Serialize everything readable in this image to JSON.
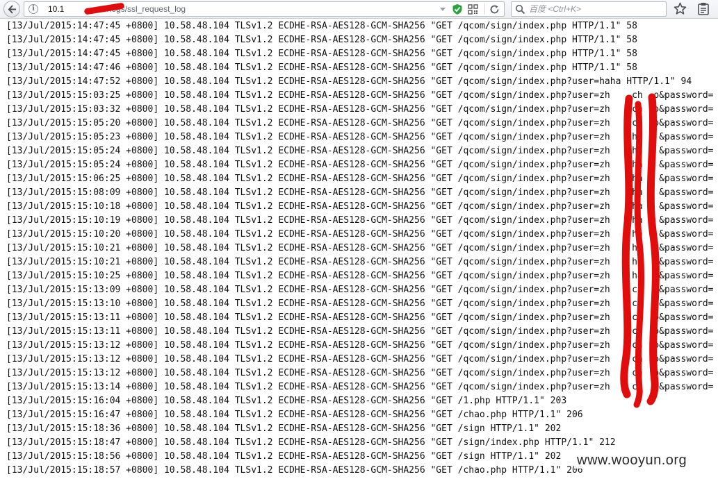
{
  "browser": {
    "url_host": "10.1",
    "url_path": "/logs/ssl_request_log",
    "search_placeholder": "百度 <Ctrl+K>",
    "icons": {
      "back": "back-arrow-icon",
      "info": "info-icon",
      "dropdown": "chevron-down-icon",
      "shield": "shield-check-icon",
      "qr": "qr-code-icon",
      "reload": "reload-icon",
      "search": "search-icon",
      "bookmark": "star-icon",
      "clipboard": "clipboard-icon"
    },
    "colors": {
      "shield": "#29a33b",
      "redaction": "#e10d0d"
    }
  },
  "log": {
    "lines": [
      "[13/Jul/2015:14:47:45 +0800] 10.58.48.104 TLSv1.2 ECDHE-RSA-AES128-GCM-SHA256 \"GET /qcom/sign/index.php HTTP/1.1\" 58",
      "[13/Jul/2015:14:47:45 +0800] 10.58.48.104 TLSv1.2 ECDHE-RSA-AES128-GCM-SHA256 \"GET /qcom/sign/index.php HTTP/1.1\" 58",
      "[13/Jul/2015:14:47:45 +0800] 10.58.48.104 TLSv1.2 ECDHE-RSA-AES128-GCM-SHA256 \"GET /qcom/sign/index.php HTTP/1.1\" 58",
      "[13/Jul/2015:14:47:46 +0800] 10.58.48.104 TLSv1.2 ECDHE-RSA-AES128-GCM-SHA256 \"GET /qcom/sign/index.php HTTP/1.1\" 58",
      "[13/Jul/2015:14:47:52 +0800] 10.58.48.104 TLSv1.2 ECDHE-RSA-AES128-GCM-SHA256 \"GET /qcom/sign/index.php?user=haha HTTP/1.1\" 94",
      "[13/Jul/2015:15:03:25 +0800] 10.58.48.104 TLSv1.2 ECDHE-RSA-AES128-GCM-SHA256 \"GET /qcom/sign/index.php?user=zh    ch  o&password=",
      "[13/Jul/2015:15:03:32 +0800] 10.58.48.104 TLSv1.2 ECDHE-RSA-AES128-GCM-SHA256 \"GET /qcom/sign/index.php?user=zh    ch  o&password=",
      "[13/Jul/2015:15:05:20 +0800] 10.58.48.104 TLSv1.2 ECDHE-RSA-AES128-GCM-SHA256 \"GET /qcom/sign/index.php?user=zh    ch  o&password=",
      "[13/Jul/2015:15:05:23 +0800] 10.58.48.104 TLSv1.2 ECDHE-RSA-AES128-GCM-SHA256 \"GET /qcom/sign/index.php?user=zh    ha   &password=",
      "[13/Jul/2015:15:05:24 +0800] 10.58.48.104 TLSv1.2 ECDHE-RSA-AES128-GCM-SHA256 \"GET /qcom/sign/index.php?user=zh    ha   &password=",
      "[13/Jul/2015:15:05:24 +0800] 10.58.48.104 TLSv1.2 ECDHE-RSA-AES128-GCM-SHA256 \"GET /qcom/sign/index.php?user=zh    ha   &password=",
      "[13/Jul/2015:15:06:25 +0800] 10.58.48.104 TLSv1.2 ECDHE-RSA-AES128-GCM-SHA256 \"GET /qcom/sign/index.php?user=zh    ha   &password=",
      "[13/Jul/2015:15:08:09 +0800] 10.58.48.104 TLSv1.2 ECDHE-RSA-AES128-GCM-SHA256 \"GET /qcom/sign/index.php?user=zh    ha   &password=",
      "[13/Jul/2015:15:10:18 +0800] 10.58.48.104 TLSv1.2 ECDHE-RSA-AES128-GCM-SHA256 \"GET /qcom/sign/index.php?user=zh    ha   &password=",
      "[13/Jul/2015:15:10:19 +0800] 10.58.48.104 TLSv1.2 ECDHE-RSA-AES128-GCM-SHA256 \"GET /qcom/sign/index.php?user=zh    ha   &password=",
      "[13/Jul/2015:15:10:20 +0800] 10.58.48.104 TLSv1.2 ECDHE-RSA-AES128-GCM-SHA256 \"GET /qcom/sign/index.php?user=zh    ha   &password=",
      "[13/Jul/2015:15:10:21 +0800] 10.58.48.104 TLSv1.2 ECDHE-RSA-AES128-GCM-SHA256 \"GET /qcom/sign/index.php?user=zh    ha   &password=",
      "[13/Jul/2015:15:10:21 +0800] 10.58.48.104 TLSv1.2 ECDHE-RSA-AES128-GCM-SHA256 \"GET /qcom/sign/index.php?user=zh    ha   &password=",
      "[13/Jul/2015:15:10:25 +0800] 10.58.48.104 TLSv1.2 ECDHE-RSA-AES128-GCM-SHA256 \"GET /qcom/sign/index.php?user=zh    ha   &password=",
      "[13/Jul/2015:15:13:09 +0800] 10.58.48.104 TLSv1.2 ECDHE-RSA-AES128-GCM-SHA256 \"GET /qcom/sign/index.php?user=zh    ch  o&password=",
      "[13/Jul/2015:15:13:10 +0800] 10.58.48.104 TLSv1.2 ECDHE-RSA-AES128-GCM-SHA256 \"GET /qcom/sign/index.php?user=zh    ch  o&password=",
      "[13/Jul/2015:15:13:11 +0800] 10.58.48.104 TLSv1.2 ECDHE-RSA-AES128-GCM-SHA256 \"GET /qcom/sign/index.php?user=zh    ch  o&password=",
      "[13/Jul/2015:15:13:11 +0800] 10.58.48.104 TLSv1.2 ECDHE-RSA-AES128-GCM-SHA256 \"GET /qcom/sign/index.php?user=zh    ch  o&password=",
      "[13/Jul/2015:15:13:12 +0800] 10.58.48.104 TLSv1.2 ECDHE-RSA-AES128-GCM-SHA256 \"GET /qcom/sign/index.php?user=zh    ch  o&password=",
      "[13/Jul/2015:15:13:12 +0800] 10.58.48.104 TLSv1.2 ECDHE-RSA-AES128-GCM-SHA256 \"GET /qcom/sign/index.php?user=zh    ch  o&password=",
      "[13/Jul/2015:15:13:12 +0800] 10.58.48.104 TLSv1.2 ECDHE-RSA-AES128-GCM-SHA256 \"GET /qcom/sign/index.php?user=zh    ch  o&password=",
      "[13/Jul/2015:15:13:14 +0800] 10.58.48.104 TLSv1.2 ECDHE-RSA-AES128-GCM-SHA256 \"GET /qcom/sign/index.php?user=zh    ch  o&password=",
      "[13/Jul/2015:15:16:04 +0800] 10.58.48.104 TLSv1.2 ECDHE-RSA-AES128-GCM-SHA256 \"GET /1.php HTTP/1.1\" 203",
      "[13/Jul/2015:15:16:47 +0800] 10.58.48.104 TLSv1.2 ECDHE-RSA-AES128-GCM-SHA256 \"GET /chao.php HTTP/1.1\" 206",
      "[13/Jul/2015:15:18:36 +0800] 10.58.48.104 TLSv1.2 ECDHE-RSA-AES128-GCM-SHA256 \"GET /sign HTTP/1.1\" 202",
      "[13/Jul/2015:15:18:47 +0800] 10.58.48.104 TLSv1.2 ECDHE-RSA-AES128-GCM-SHA256 \"GET /sign/index.php HTTP/1.1\" 212",
      "[13/Jul/2015:15:18:56 +0800] 10.58.48.104 TLSv1.2 ECDHE-RSA-AES128-GCM-SHA256 \"GET /sign HTTP/1.1\" 202",
      "[13/Jul/2015:15:18:57 +0800] 10.58.48.104 TLSv1.2 ECDHE-RSA-AES128-GCM-SHA256 \"GET /chao.php HTTP/1.1\" 206"
    ]
  },
  "watermark": "www.wooyun.org"
}
